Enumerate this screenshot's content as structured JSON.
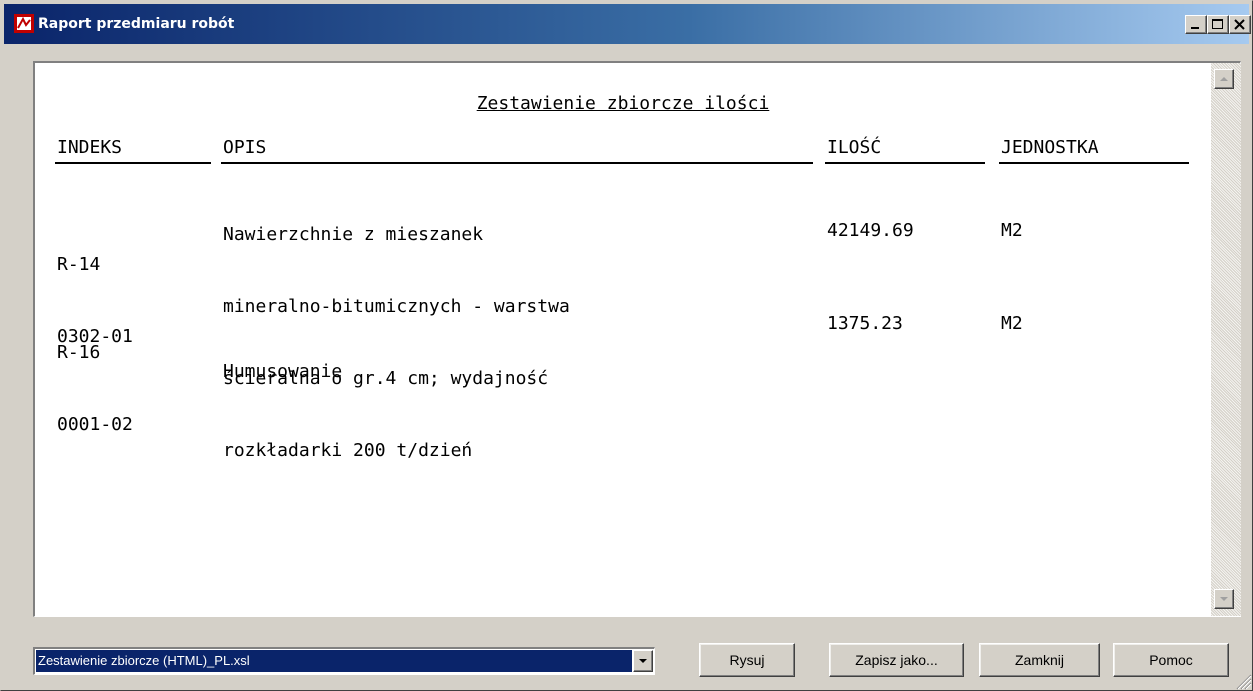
{
  "window": {
    "title": "Raport przedmiaru robót",
    "controls": [
      "minimize",
      "maximize",
      "close"
    ]
  },
  "report": {
    "title": "Zestawienie zbiorcze ilości",
    "columns": [
      "INDEKS",
      "OPIS",
      "ILOŚĆ",
      "JEDNOSTKA"
    ],
    "rows": [
      {
        "index": [
          "R-14",
          "0302-01"
        ],
        "description": [
          "Nawierzchnie z mieszanek",
          "mineralno-bitumicznych - warstwa",
          "ścieralna o gr.4 cm; wydajność",
          "rozkładarki 200 t/dzień"
        ],
        "quantity": "42149.69",
        "unit": "M2"
      },
      {
        "index": [
          "R-16",
          "0001-02"
        ],
        "description": [
          "Humusowanie"
        ],
        "quantity": "1375.23",
        "unit": "M2"
      }
    ]
  },
  "template_select": {
    "value": "Zestawienie zbiorcze (HTML)_PL.xsl"
  },
  "buttons": {
    "draw": "Rysuj",
    "save_as": "Zapisz jako...",
    "close": "Zamknij",
    "help": "Pomoc"
  },
  "colors": {
    "titlebar_start": "#0a246a",
    "titlebar_end": "#a6caf0",
    "face": "#d4d0c8",
    "selection": "#0a246a"
  }
}
